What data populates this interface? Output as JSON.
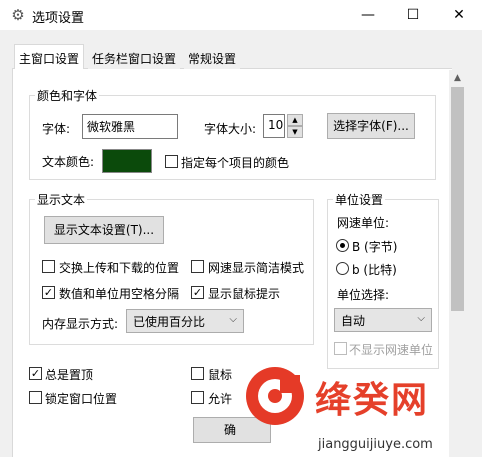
{
  "window": {
    "title": "选项设置",
    "icon": "gear-icon",
    "minimize_glyph": "—",
    "maximize_glyph": "☐",
    "close_glyph": "✕"
  },
  "tabs": [
    {
      "label": "主窗口设置",
      "active": true
    },
    {
      "label": "任务栏窗口设置",
      "active": false
    },
    {
      "label": "常规设置",
      "active": false
    }
  ],
  "color_font": {
    "group_title": "颜色和字体",
    "font_label": "字体:",
    "font_value": "微软雅黑",
    "size_label": "字体大小:",
    "size_value": "10",
    "choose_font_button": "选择字体(F)...",
    "text_color_label": "文本颜色:",
    "text_color": "#0b4a0b",
    "per_item_color_label": "指定每个项目的颜色",
    "per_item_color_checked": false
  },
  "display_text": {
    "group_title": "显示文本",
    "settings_button": "显示文本设置(T)...",
    "swap_updown_label": "交换上传和下载的位置",
    "swap_updown_checked": false,
    "simple_mode_label": "网速显示简洁模式",
    "simple_mode_checked": false,
    "space_separate_label": "数值和单位用空格分隔",
    "space_separate_checked": true,
    "mouse_tip_label": "显示鼠标提示",
    "mouse_tip_checked": true,
    "memory_display_label": "内存显示方式:",
    "memory_display_value": "已使用百分比"
  },
  "unit": {
    "group_title": "单位设置",
    "speed_unit_label": "网速单位:",
    "byte_option": "B (字节)",
    "bit_option": "b (比特)",
    "selected": "B",
    "unit_select_label": "单位选择:",
    "unit_select_value": "自动",
    "hide_unit_label": "不显示网速单位"
  },
  "bottom": {
    "always_top_label": "总是置顶",
    "always_top_checked": true,
    "lock_window_label": "锁定窗口位置",
    "lock_window_checked": false,
    "mouse_partial_label": "鼠标",
    "allow_partial_label": "允许",
    "ok_button_partial": "确"
  },
  "watermark": {
    "text": "绛癸网",
    "url": "jiangguijiuye.com"
  },
  "icons": {
    "up_arrow": "▲",
    "down_arrow": "▼",
    "combo_arrow": "⌵",
    "check": "✓"
  }
}
